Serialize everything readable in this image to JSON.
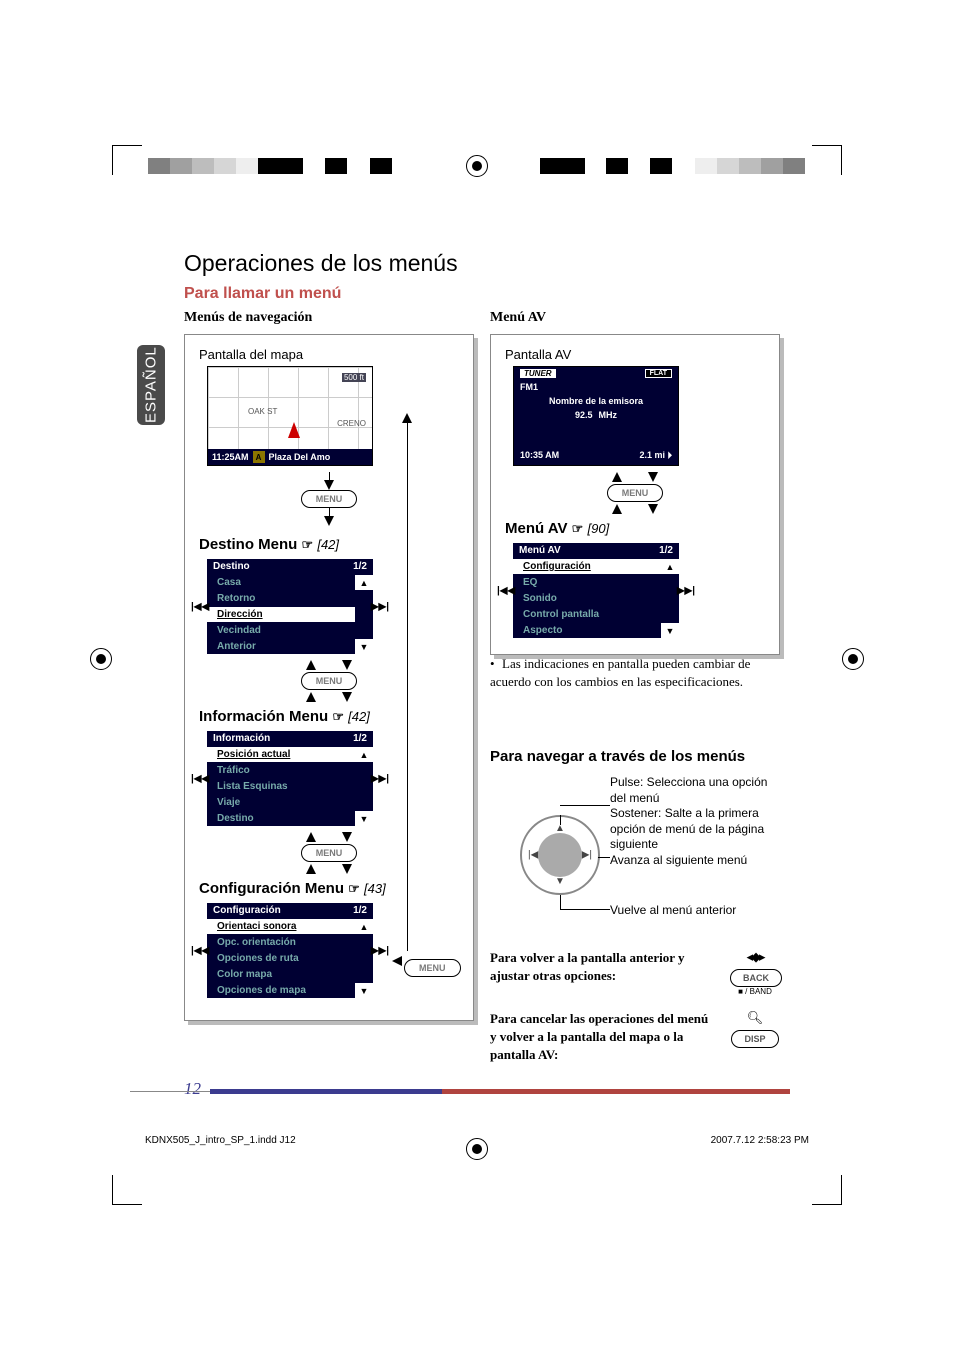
{
  "sideTab": "ESPAÑOL",
  "mainHeading": "Operaciones de los menús",
  "subHeading": "Para llamar un menú",
  "left": {
    "sectionHead": "Menús de navegación",
    "mapCaption": "Pantalla del mapa",
    "map": {
      "oak": "OAK ST",
      "creno": "CRENO",
      "time": "11:25AM",
      "a": "A",
      "place": "Plaza Del Amo",
      "scale": "500 ft"
    },
    "menuBtn": "MENU",
    "destino": {
      "title": "Destino Menu",
      "ref": "[42]",
      "header": "Destino",
      "page": "1/2",
      "items": [
        "Casa",
        "Retorno",
        "Dirección",
        "Vecindad",
        "Anterior"
      ],
      "selected": 2
    },
    "informacion": {
      "title": "Información Menu",
      "ref": "[42]",
      "header": "Información",
      "page": "1/2",
      "items": [
        "Posición actual",
        "Tráfico",
        "Lista Esquinas",
        "Viaje",
        "Destino"
      ],
      "selected": 0
    },
    "config": {
      "title": "Configuración Menu",
      "ref": "[43]",
      "header": "Configuración",
      "page": "1/2",
      "items": [
        "Orientaci sonora",
        "Opc. orientación",
        "Opciones de ruta",
        "Color mapa",
        "Opciones de mapa"
      ],
      "selected": 0
    }
  },
  "right": {
    "sectionHead": "Menú AV",
    "avCaption": "Pantalla AV",
    "av": {
      "tuner": "TUNER",
      "flat": "FLAT",
      "fm": "FM1",
      "name": "Nombre de la emisora",
      "freq": "92.5",
      "mhz": "MHz",
      "time": "10:35 AM",
      "dist": "2.1 mi"
    },
    "menuBtn": "MENU",
    "avmenu": {
      "title": "Menú AV",
      "ref": "[90]",
      "header": "Menú AV",
      "page": "1/2",
      "items": [
        "Configuración",
        "EQ",
        "Sonido",
        "Control pantalla",
        "Aspecto"
      ],
      "selected": 0
    },
    "note": "Las indicaciones en pantalla pueden cambiar de acuerdo con los cambios en las especificaciones.",
    "navHeading": "Para navegar a través de los menús",
    "dialLabels": {
      "push": "Pulse: Selecciona una opción del menú",
      "hold": "Sostener: Salte a la primera opción de menú de la página siguiente",
      "next": "Avanza al siguiente menú",
      "prev": "Vuelve al menú anterior"
    },
    "returnText": "Para volver a la pantalla anterior y ajustar otras opciones:",
    "cancelText": "Para cancelar las operaciones del menú y volver a la pantalla del mapa o la pantalla AV:",
    "backBtn": "BACK",
    "backSub": "■ / BAND",
    "dispBtn": "DISP"
  },
  "sideMenuBtn": "MENU",
  "pageNum": "12",
  "footerLeft": "KDNX505_J_intro_SP_1.indd   J12",
  "footerRight": "2007.7.12   2:58:23 PM"
}
